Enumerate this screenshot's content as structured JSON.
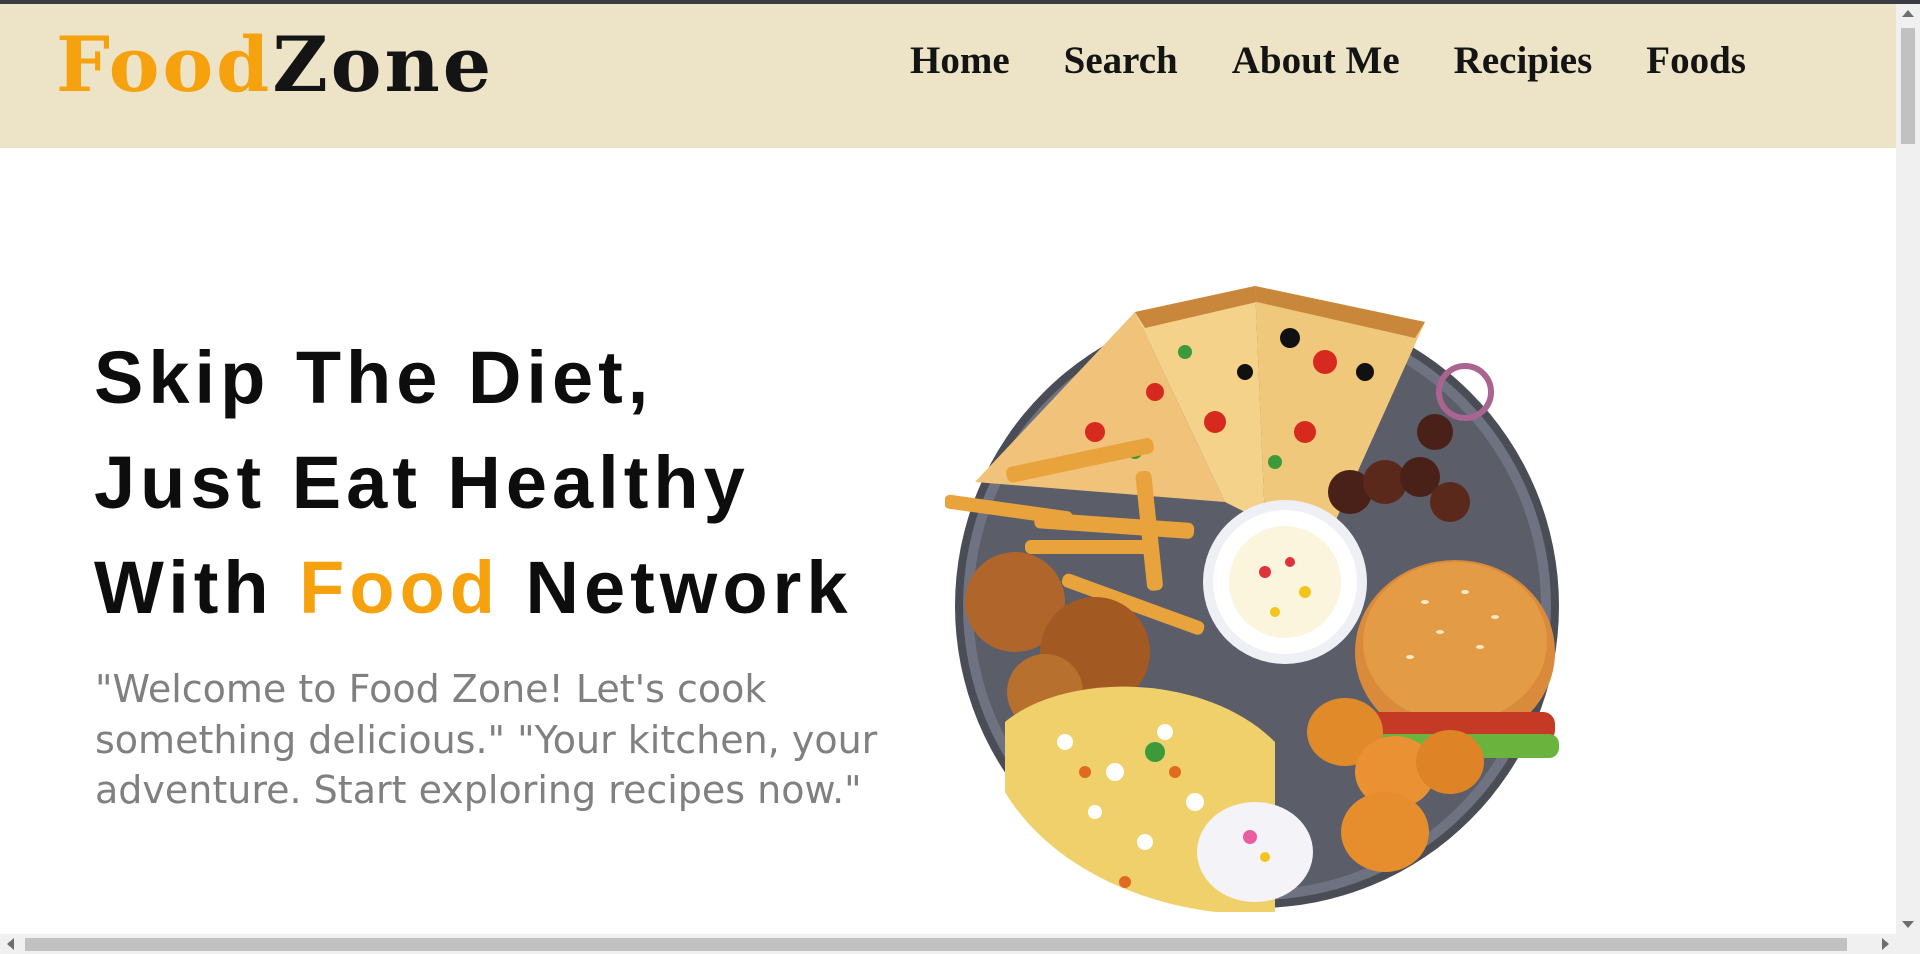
{
  "brand": {
    "part1": "Food",
    "part2": "Zone"
  },
  "nav": [
    {
      "label": "Home"
    },
    {
      "label": "Search"
    },
    {
      "label": "About Me"
    },
    {
      "label": "Recipies"
    },
    {
      "label": "Foods"
    }
  ],
  "hero": {
    "line1": "Skip The Diet,",
    "line2": "Just Eat Healthy",
    "line3_pre": "With ",
    "line3_accent": "Food",
    "line3_post": " Network",
    "description": "\"Welcome to Food Zone! Let's cook something delicious.\" \"Your kitchen, your adventure. Start exploring recipes now.\""
  },
  "colors": {
    "accent": "#f5a20e",
    "header_bg": "#ede4c8",
    "text_dark": "#0d0d0d",
    "text_gray": "#808080"
  },
  "icons": [
    "food-platter-image",
    "scroll-up-arrow-icon",
    "scroll-down-arrow-icon",
    "scroll-left-arrow-icon",
    "scroll-right-arrow-icon"
  ]
}
